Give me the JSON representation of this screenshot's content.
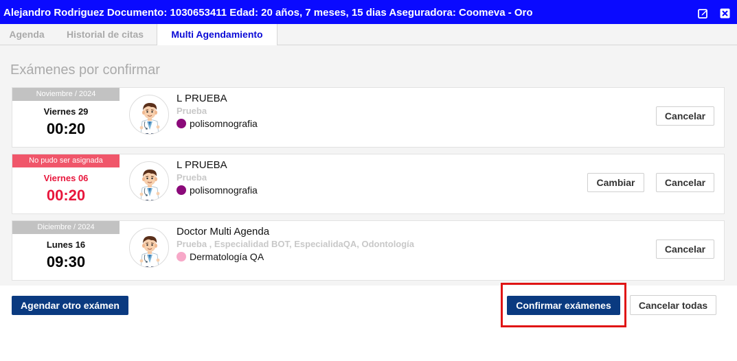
{
  "header": {
    "title": "Alejandro Rodriguez  Documento: 1030653411  Edad: 20 años, 7 meses, 15 dias  Aseguradora: Coomeva  - Oro",
    "edit_icon": "edit-square-icon",
    "close_icon": "close-icon"
  },
  "tabs": [
    {
      "label": "Agenda"
    },
    {
      "label": "Historial de citas"
    },
    {
      "label": "Multi Agendamiento",
      "active": true
    }
  ],
  "section_title": "Exámenes por confirmar",
  "appointments": [
    {
      "month": "Noviembre / 2024",
      "day": "Viernes 29",
      "time": "00:20",
      "doctor": "L PRUEBA",
      "specialty": "Prueba",
      "exam": "polisomnografia",
      "exam_color": "#8b0a7a",
      "status": "ok",
      "cancel_label": "Cancelar"
    },
    {
      "month": "No pudo ser asignada",
      "day": "Viernes 06",
      "time": "00:20",
      "doctor": "L PRUEBA",
      "specialty": "Prueba",
      "exam": "polisomnografia",
      "exam_color": "#8b0a7a",
      "status": "error",
      "change_label": "Cambiar",
      "cancel_label": "Cancelar"
    },
    {
      "month": "Diciembre / 2024",
      "day": "Lunes 16",
      "time": "09:30",
      "doctor": "Doctor Multi Agenda",
      "specialty": "Prueba , Especialidad BOT, EspecialidaQA, Odontología",
      "exam": "Dermatología QA",
      "exam_color": "#f7a8c8",
      "status": "ok",
      "cancel_label": "Cancelar"
    }
  ],
  "footer": {
    "add_exam_label": "Agendar otro exámen",
    "confirm_label": "Confirmar exámenes",
    "cancel_all_label": "Cancelar todas"
  },
  "colors": {
    "header_bg": "#0a0aff",
    "primary_button": "#0a3a80",
    "error": "#e8163c",
    "error_band": "#f0566a",
    "highlight": "#e01414"
  }
}
